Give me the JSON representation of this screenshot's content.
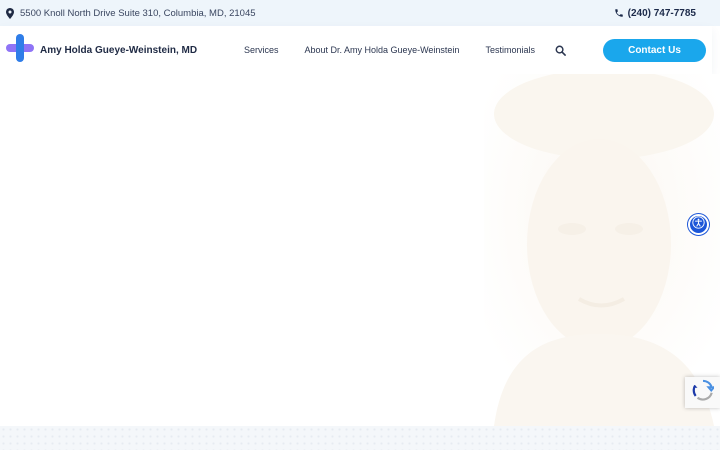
{
  "topbar": {
    "address": "5500 Knoll North Drive Suite 310, Columbia, MD, 21045",
    "address_icon": "map-pin-icon",
    "phone": "(240) 747-7785",
    "phone_icon": "phone-icon"
  },
  "header": {
    "brand_name": "Amy Holda Gueye-Weinstein, MD",
    "logo_icon": "medical-cross-icon",
    "nav": {
      "services": "Services",
      "about": "About Dr. Amy Holda Gueye-Weinstein",
      "testimonials": "Testimonials"
    },
    "search_icon": "search-icon",
    "contact_label": "Contact Us"
  },
  "widgets": {
    "accessibility_icon": "accessibility-icon",
    "recaptcha_icon": "recaptcha-icon"
  },
  "colors": {
    "topbar_bg": "#eef5fb",
    "accent": "#1aa7ec",
    "logo_blue": "#2f7de8",
    "logo_purple": "#7b5cf5",
    "accessibility_blue": "#1c56d8",
    "text_dark": "#1f2a44"
  }
}
